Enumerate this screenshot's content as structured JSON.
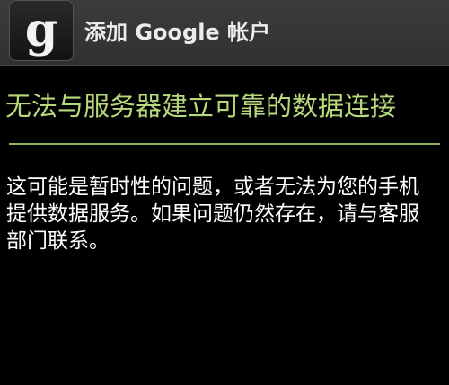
{
  "header": {
    "app_icon": "google-g-icon",
    "title": "添加 Google 帐户"
  },
  "dialog": {
    "title": "无法与服务器建立可靠的数据连接",
    "message_lines": [
      "这可能是暂时性的问题，或者无法为您的手机",
      "提供数据服务。如果问题仍然存在，请与客服",
      "部门联系。"
    ]
  },
  "colors": {
    "title_bar": "#333333",
    "dialog_title": "#b7d97c",
    "divider": "#8fb05c",
    "background": "#000000",
    "text": "#ffffff"
  }
}
